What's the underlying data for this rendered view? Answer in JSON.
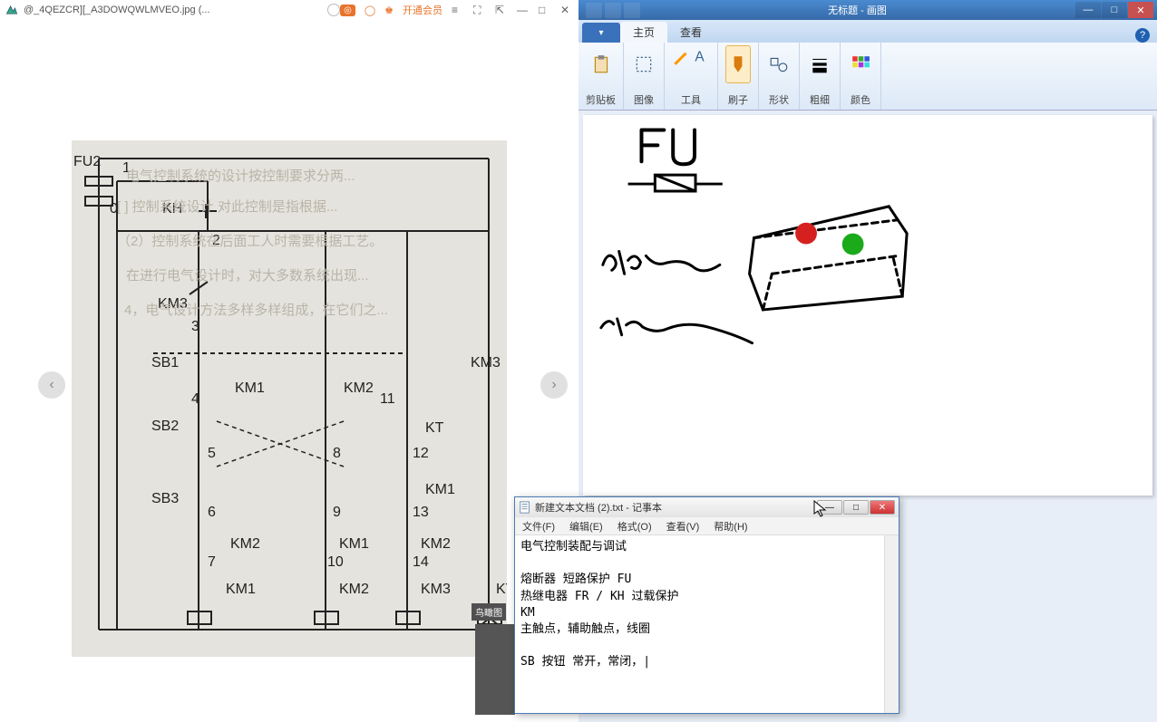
{
  "viewer": {
    "title": "@_4QEZCR][_A3DOWQWLMVEO.jpg (...",
    "member_link": "开通会员",
    "minimap_label": "鸟瞰图",
    "diagram": {
      "labels": [
        "FU2",
        "KH",
        "KM3",
        "SB1",
        "KM1",
        "KM2",
        "KM3",
        "SB2",
        "KT",
        "SB3",
        "KM1",
        "KM2",
        "KM1",
        "KM2",
        "KM1",
        "KM2",
        "KM3",
        "KT"
      ],
      "numbers": [
        "0",
        "1",
        "2",
        "3",
        "4",
        "5",
        "6",
        "7",
        "8",
        "9",
        "10",
        "11",
        "12",
        "13",
        "14"
      ]
    }
  },
  "paint": {
    "title": "无标题 - 画图",
    "tabs": {
      "home": "主页",
      "view": "查看"
    },
    "ribbon": {
      "clipboard": "剪贴板",
      "image": "图像",
      "tools": "工具",
      "brushes": "刷子",
      "shapes": "形状",
      "size": "粗细",
      "colors": "颜色"
    },
    "sketch_text": "FU"
  },
  "notepad": {
    "title": "新建文本文档 (2).txt - 记事本",
    "menu": {
      "file": "文件(F)",
      "edit": "编辑(E)",
      "format": "格式(O)",
      "view": "查看(V)",
      "help": "帮助(H)"
    },
    "content": "电气控制装配与调试\n\n熔断器 短路保护 FU\n热继电器 FR / KH 过载保护\nKM\n主触点，辅助触点，线圈\n\nSB 按钮 常开，常闭，|"
  }
}
